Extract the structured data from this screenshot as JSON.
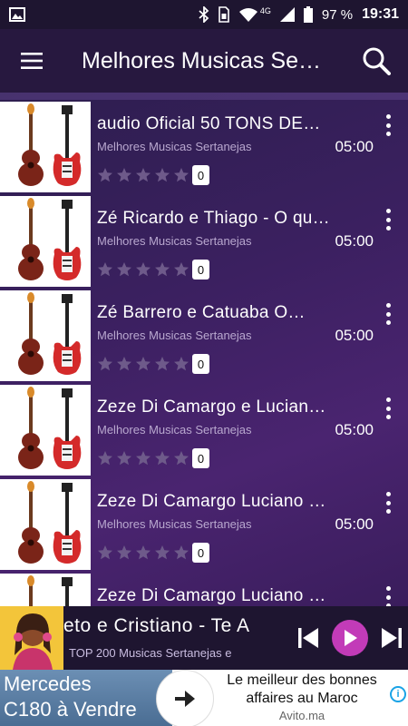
{
  "status_bar": {
    "network_label": "4G",
    "battery": "97 %",
    "time": "19:31"
  },
  "app_bar": {
    "title": "Melhores Musicas Se…",
    "menu_icon": "hamburger-menu-icon",
    "search_icon": "search-icon"
  },
  "songs": [
    {
      "title": "audio Oficial  50 TONS DE…",
      "subtitle": "Melhores Musicas Sertanejas",
      "duration": "05:00",
      "rating_count": "0"
    },
    {
      "title": "Zé Ricardo e Thiago - O qu…",
      "subtitle": "Melhores Musicas Sertanejas",
      "duration": "05:00",
      "rating_count": "0"
    },
    {
      "title": "Zé Barrero e Catuaba   O…",
      "subtitle": "Melhores Musicas Sertanejas",
      "duration": "05:00",
      "rating_count": "0"
    },
    {
      "title": "Zeze Di Camargo e Lucian…",
      "subtitle": "Melhores Musicas Sertanejas",
      "duration": "05:00",
      "rating_count": "0"
    },
    {
      "title": "Zeze Di Camargo  Luciano …",
      "subtitle": "Melhores Musicas Sertanejas",
      "duration": "05:00",
      "rating_count": "0"
    },
    {
      "title": "Zeze Di Camargo  Luciano …",
      "subtitle": "",
      "duration": "",
      "rating_count": ""
    }
  ],
  "player": {
    "title": "eto e Cristiano - Te A",
    "subtitle": "TOP 200 Musicas Sertanejas e"
  },
  "ad": {
    "left_text_line1": "Mercedes",
    "left_text_line2": "C180 à Vendre",
    "right_line1": "Le meilleur des bonnes",
    "right_line2": "affaires au Maroc",
    "source": "Avito.ma",
    "info_label": "i"
  },
  "colors": {
    "accent": "#c23bb8",
    "app_bar": "#27183f",
    "list_bg": "#3b2060"
  }
}
